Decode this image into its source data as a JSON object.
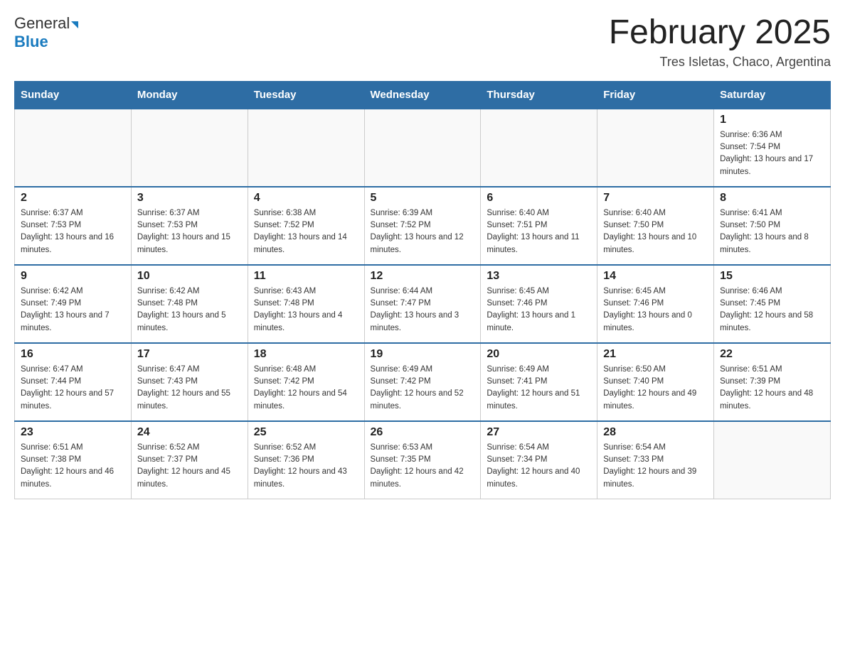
{
  "logo": {
    "line1": "General",
    "line2": "Blue"
  },
  "title": "February 2025",
  "subtitle": "Tres Isletas, Chaco, Argentina",
  "days_of_week": [
    "Sunday",
    "Monday",
    "Tuesday",
    "Wednesday",
    "Thursday",
    "Friday",
    "Saturday"
  ],
  "weeks": [
    [
      {
        "day": "",
        "info": ""
      },
      {
        "day": "",
        "info": ""
      },
      {
        "day": "",
        "info": ""
      },
      {
        "day": "",
        "info": ""
      },
      {
        "day": "",
        "info": ""
      },
      {
        "day": "",
        "info": ""
      },
      {
        "day": "1",
        "info": "Sunrise: 6:36 AM\nSunset: 7:54 PM\nDaylight: 13 hours and 17 minutes."
      }
    ],
    [
      {
        "day": "2",
        "info": "Sunrise: 6:37 AM\nSunset: 7:53 PM\nDaylight: 13 hours and 16 minutes."
      },
      {
        "day": "3",
        "info": "Sunrise: 6:37 AM\nSunset: 7:53 PM\nDaylight: 13 hours and 15 minutes."
      },
      {
        "day": "4",
        "info": "Sunrise: 6:38 AM\nSunset: 7:52 PM\nDaylight: 13 hours and 14 minutes."
      },
      {
        "day": "5",
        "info": "Sunrise: 6:39 AM\nSunset: 7:52 PM\nDaylight: 13 hours and 12 minutes."
      },
      {
        "day": "6",
        "info": "Sunrise: 6:40 AM\nSunset: 7:51 PM\nDaylight: 13 hours and 11 minutes."
      },
      {
        "day": "7",
        "info": "Sunrise: 6:40 AM\nSunset: 7:50 PM\nDaylight: 13 hours and 10 minutes."
      },
      {
        "day": "8",
        "info": "Sunrise: 6:41 AM\nSunset: 7:50 PM\nDaylight: 13 hours and 8 minutes."
      }
    ],
    [
      {
        "day": "9",
        "info": "Sunrise: 6:42 AM\nSunset: 7:49 PM\nDaylight: 13 hours and 7 minutes."
      },
      {
        "day": "10",
        "info": "Sunrise: 6:42 AM\nSunset: 7:48 PM\nDaylight: 13 hours and 5 minutes."
      },
      {
        "day": "11",
        "info": "Sunrise: 6:43 AM\nSunset: 7:48 PM\nDaylight: 13 hours and 4 minutes."
      },
      {
        "day": "12",
        "info": "Sunrise: 6:44 AM\nSunset: 7:47 PM\nDaylight: 13 hours and 3 minutes."
      },
      {
        "day": "13",
        "info": "Sunrise: 6:45 AM\nSunset: 7:46 PM\nDaylight: 13 hours and 1 minute."
      },
      {
        "day": "14",
        "info": "Sunrise: 6:45 AM\nSunset: 7:46 PM\nDaylight: 13 hours and 0 minutes."
      },
      {
        "day": "15",
        "info": "Sunrise: 6:46 AM\nSunset: 7:45 PM\nDaylight: 12 hours and 58 minutes."
      }
    ],
    [
      {
        "day": "16",
        "info": "Sunrise: 6:47 AM\nSunset: 7:44 PM\nDaylight: 12 hours and 57 minutes."
      },
      {
        "day": "17",
        "info": "Sunrise: 6:47 AM\nSunset: 7:43 PM\nDaylight: 12 hours and 55 minutes."
      },
      {
        "day": "18",
        "info": "Sunrise: 6:48 AM\nSunset: 7:42 PM\nDaylight: 12 hours and 54 minutes."
      },
      {
        "day": "19",
        "info": "Sunrise: 6:49 AM\nSunset: 7:42 PM\nDaylight: 12 hours and 52 minutes."
      },
      {
        "day": "20",
        "info": "Sunrise: 6:49 AM\nSunset: 7:41 PM\nDaylight: 12 hours and 51 minutes."
      },
      {
        "day": "21",
        "info": "Sunrise: 6:50 AM\nSunset: 7:40 PM\nDaylight: 12 hours and 49 minutes."
      },
      {
        "day": "22",
        "info": "Sunrise: 6:51 AM\nSunset: 7:39 PM\nDaylight: 12 hours and 48 minutes."
      }
    ],
    [
      {
        "day": "23",
        "info": "Sunrise: 6:51 AM\nSunset: 7:38 PM\nDaylight: 12 hours and 46 minutes."
      },
      {
        "day": "24",
        "info": "Sunrise: 6:52 AM\nSunset: 7:37 PM\nDaylight: 12 hours and 45 minutes."
      },
      {
        "day": "25",
        "info": "Sunrise: 6:52 AM\nSunset: 7:36 PM\nDaylight: 12 hours and 43 minutes."
      },
      {
        "day": "26",
        "info": "Sunrise: 6:53 AM\nSunset: 7:35 PM\nDaylight: 12 hours and 42 minutes."
      },
      {
        "day": "27",
        "info": "Sunrise: 6:54 AM\nSunset: 7:34 PM\nDaylight: 12 hours and 40 minutes."
      },
      {
        "day": "28",
        "info": "Sunrise: 6:54 AM\nSunset: 7:33 PM\nDaylight: 12 hours and 39 minutes."
      },
      {
        "day": "",
        "info": ""
      }
    ]
  ]
}
